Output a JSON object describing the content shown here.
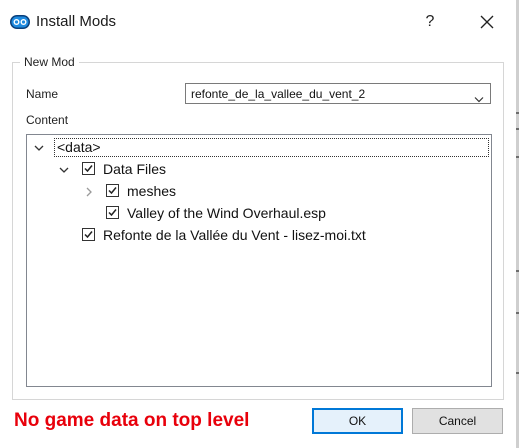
{
  "window": {
    "title": "Install Mods",
    "help_label": "?",
    "app_icon": "mod-organizer-icon",
    "close_icon": "close-icon"
  },
  "group": {
    "title": "New Mod"
  },
  "name_field": {
    "label": "Name",
    "value": "refonte_de_la_vallee_du_vent_2",
    "arrow_icon": "chevron-down-icon"
  },
  "content": {
    "label": "Content",
    "tree": [
      {
        "label": "<data>",
        "expanded": true,
        "has_checkbox": false,
        "level": 0
      },
      {
        "label": "Data Files",
        "expanded": true,
        "checked": true,
        "level": 1
      },
      {
        "label": "meshes",
        "expanded": false,
        "checked": true,
        "level": 2
      },
      {
        "label": "Valley of the Wind Overhaul.esp",
        "checked": true,
        "level": 2
      },
      {
        "label": "Refonte de la Vallée du Vent - lisez-moi.txt",
        "checked": true,
        "level": 1
      }
    ]
  },
  "status": {
    "error": "No game data on top level",
    "error_color": "#e8000b"
  },
  "buttons": {
    "ok": "OK",
    "cancel": "Cancel"
  },
  "colors": {
    "accent": "#0078d7"
  }
}
